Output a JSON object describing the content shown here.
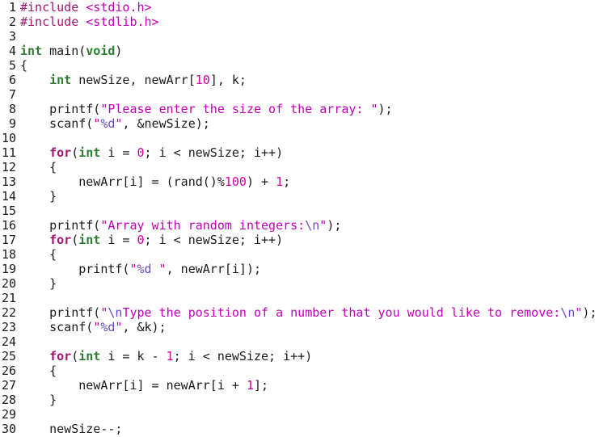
{
  "editor": {
    "colors": {
      "keyword": "#a0176f",
      "type": "#2e7d32",
      "number": "#d000a8",
      "string": "#c000b8",
      "escape": "#6a48c8",
      "text": "#1a1a1a"
    },
    "lines": [
      {
        "n": "1",
        "tokens": [
          [
            "pp",
            "#include "
          ],
          [
            "inc",
            "<stdio.h>"
          ]
        ]
      },
      {
        "n": "2",
        "tokens": [
          [
            "pp",
            "#include "
          ],
          [
            "inc",
            "<stdlib.h>"
          ]
        ]
      },
      {
        "n": "3",
        "tokens": []
      },
      {
        "n": "4",
        "tokens": [
          [
            "ty",
            "int"
          ],
          [
            "id",
            " main("
          ],
          [
            "ty",
            "void"
          ],
          [
            "id",
            ")"
          ]
        ]
      },
      {
        "n": "5",
        "tokens": [
          [
            "id",
            "{"
          ]
        ]
      },
      {
        "n": "6",
        "tokens": [
          [
            "id",
            "    "
          ],
          [
            "ty",
            "int"
          ],
          [
            "id",
            " newSize, newArr["
          ],
          [
            "num",
            "10"
          ],
          [
            "id",
            "], k;"
          ]
        ]
      },
      {
        "n": "7",
        "tokens": []
      },
      {
        "n": "8",
        "tokens": [
          [
            "id",
            "    printf("
          ],
          [
            "str",
            "\"Please enter the size of the array: \""
          ],
          [
            "id",
            ");"
          ]
        ]
      },
      {
        "n": "9",
        "tokens": [
          [
            "id",
            "    scanf("
          ],
          [
            "str",
            "\""
          ],
          [
            "esc",
            "%d"
          ],
          [
            "str",
            "\""
          ],
          [
            "id",
            ", &newSize);"
          ]
        ]
      },
      {
        "n": "10",
        "tokens": []
      },
      {
        "n": "11",
        "tokens": [
          [
            "id",
            "    "
          ],
          [
            "kw",
            "for"
          ],
          [
            "id",
            "("
          ],
          [
            "ty",
            "int"
          ],
          [
            "id",
            " i = "
          ],
          [
            "num",
            "0"
          ],
          [
            "id",
            "; i < newSize; i++)"
          ]
        ]
      },
      {
        "n": "12",
        "tokens": [
          [
            "id",
            "    {"
          ]
        ]
      },
      {
        "n": "13",
        "tokens": [
          [
            "id",
            "        newArr[i] = (rand()%"
          ],
          [
            "num",
            "100"
          ],
          [
            "id",
            ") + "
          ],
          [
            "num",
            "1"
          ],
          [
            "id",
            ";"
          ]
        ]
      },
      {
        "n": "14",
        "tokens": [
          [
            "id",
            "    }"
          ]
        ]
      },
      {
        "n": "15",
        "tokens": []
      },
      {
        "n": "16",
        "tokens": [
          [
            "id",
            "    printf("
          ],
          [
            "str",
            "\"Array with random integers:"
          ],
          [
            "esc",
            "\\n"
          ],
          [
            "str",
            "\""
          ],
          [
            "id",
            ");"
          ]
        ]
      },
      {
        "n": "17",
        "tokens": [
          [
            "id",
            "    "
          ],
          [
            "kw",
            "for"
          ],
          [
            "id",
            "("
          ],
          [
            "ty",
            "int"
          ],
          [
            "id",
            " i = "
          ],
          [
            "num",
            "0"
          ],
          [
            "id",
            "; i < newSize; i++)"
          ]
        ]
      },
      {
        "n": "18",
        "tokens": [
          [
            "id",
            "    {"
          ]
        ]
      },
      {
        "n": "19",
        "tokens": [
          [
            "id",
            "        printf("
          ],
          [
            "str",
            "\""
          ],
          [
            "esc",
            "%d"
          ],
          [
            "str",
            " \""
          ],
          [
            "id",
            ", newArr[i]);"
          ]
        ]
      },
      {
        "n": "20",
        "tokens": [
          [
            "id",
            "    }"
          ]
        ]
      },
      {
        "n": "21",
        "tokens": []
      },
      {
        "n": "22",
        "tokens": [
          [
            "id",
            "    printf("
          ],
          [
            "str",
            "\""
          ],
          [
            "esc",
            "\\n"
          ],
          [
            "str",
            "Type the position of a number that you would like to remove:"
          ],
          [
            "esc",
            "\\n"
          ],
          [
            "str",
            "\""
          ],
          [
            "id",
            ");"
          ]
        ]
      },
      {
        "n": "23",
        "tokens": [
          [
            "id",
            "    scanf("
          ],
          [
            "str",
            "\""
          ],
          [
            "esc",
            "%d"
          ],
          [
            "str",
            "\""
          ],
          [
            "id",
            ", &k);"
          ]
        ]
      },
      {
        "n": "24",
        "tokens": []
      },
      {
        "n": "25",
        "tokens": [
          [
            "id",
            "    "
          ],
          [
            "kw",
            "for"
          ],
          [
            "id",
            "("
          ],
          [
            "ty",
            "int"
          ],
          [
            "id",
            " i = k - "
          ],
          [
            "num",
            "1"
          ],
          [
            "id",
            "; i < newSize; i++)"
          ]
        ]
      },
      {
        "n": "26",
        "tokens": [
          [
            "id",
            "    {"
          ]
        ]
      },
      {
        "n": "27",
        "tokens": [
          [
            "id",
            "        newArr[i] = newArr[i + "
          ],
          [
            "num",
            "1"
          ],
          [
            "id",
            "];"
          ]
        ]
      },
      {
        "n": "28",
        "tokens": [
          [
            "id",
            "    }"
          ]
        ]
      },
      {
        "n": "29",
        "tokens": []
      },
      {
        "n": "30",
        "tokens": [
          [
            "id",
            "    newSize--;"
          ]
        ]
      }
    ]
  }
}
